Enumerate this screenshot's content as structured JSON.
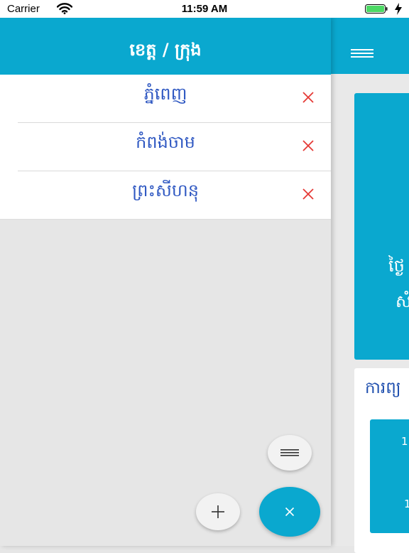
{
  "status_bar": {
    "carrier": "Carrier",
    "time": "11:59 AM"
  },
  "drawer": {
    "title": "ខេត្ត / ក្រុង",
    "provinces": [
      {
        "name": "ភ្នំពេញ"
      },
      {
        "name": "កំពង់ចាម"
      },
      {
        "name": "ព្រះសីហនុ"
      }
    ]
  },
  "main": {
    "info_lines": [
      "ថ្ងៃ",
      "សំ"
    ],
    "forecast_title": "ការព្យ",
    "tile_numbers": [
      "1",
      "1"
    ]
  },
  "colors": {
    "accent": "#0aa8cf",
    "province_text": "#2f58c2",
    "remove_icon": "#e53935"
  },
  "icons": {
    "menu": "hamburger-menu-icon",
    "remove": "close-x-icon",
    "add": "plus-icon",
    "list": "list-lines-icon",
    "close": "close-x-icon"
  }
}
